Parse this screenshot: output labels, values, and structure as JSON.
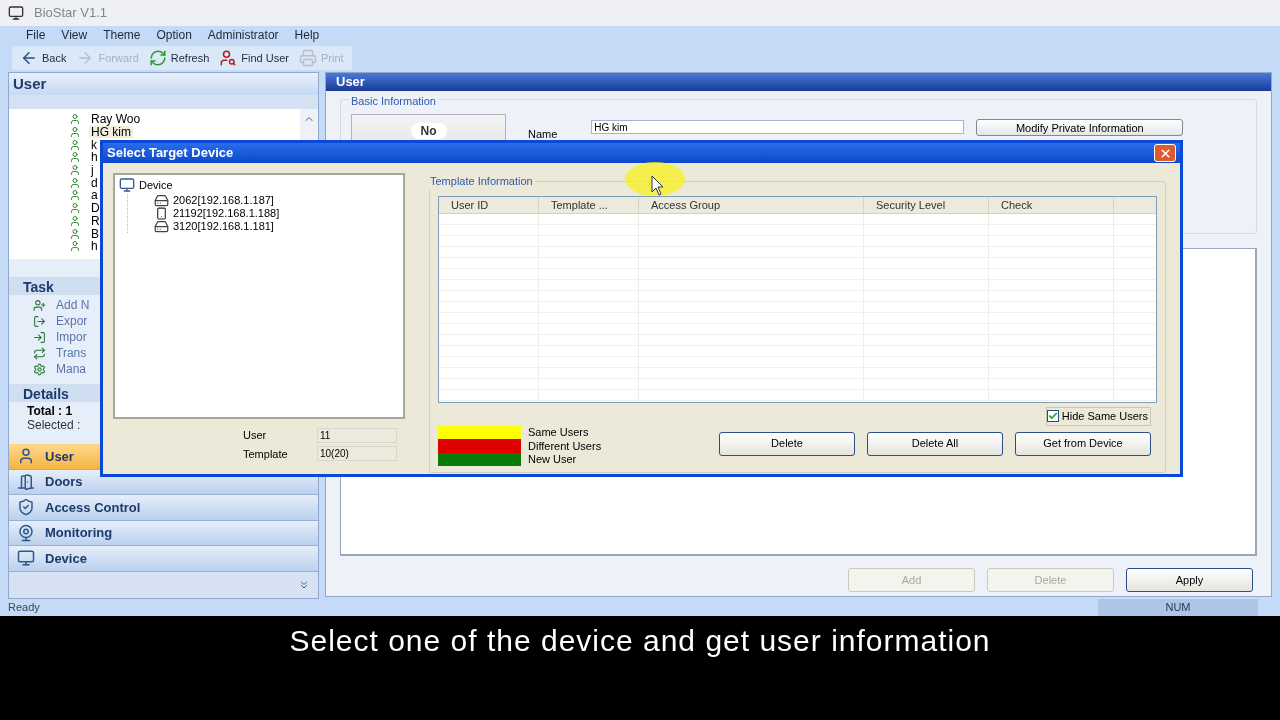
{
  "window": {
    "title": "BioStar V1.1"
  },
  "menu": [
    "File",
    "View",
    "Theme",
    "Option",
    "Administrator",
    "Help"
  ],
  "toolbar": [
    {
      "label": "Back",
      "disabled": false
    },
    {
      "label": "Forward",
      "disabled": true
    },
    {
      "label": "Refresh",
      "disabled": false
    },
    {
      "label": "Find User",
      "disabled": false
    },
    {
      "label": "Print",
      "disabled": true
    }
  ],
  "sidebar": {
    "title": "User",
    "users": [
      {
        "name": "Ray Woo",
        "selected": false
      },
      {
        "name": "HG kim",
        "selected": true
      },
      {
        "name": "k",
        "selected": false
      },
      {
        "name": "h",
        "selected": false
      },
      {
        "name": "j",
        "selected": false
      },
      {
        "name": "d",
        "selected": false
      },
      {
        "name": "a",
        "selected": false
      },
      {
        "name": "D",
        "selected": false
      },
      {
        "name": "R",
        "selected": false
      },
      {
        "name": "B",
        "selected": false
      },
      {
        "name": "h",
        "selected": false
      }
    ],
    "task": {
      "title": "Task",
      "items": [
        "Add N",
        "Expor",
        "Impor",
        "Trans",
        "Mana"
      ]
    },
    "details": {
      "title": "Details",
      "lines": [
        "Total : 1",
        "Selected :"
      ]
    },
    "nav": [
      {
        "label": "User",
        "selected": true
      },
      {
        "label": "Doors",
        "selected": false
      },
      {
        "label": "Access Control",
        "selected": false
      },
      {
        "label": "Monitoring",
        "selected": false
      },
      {
        "label": "Device",
        "selected": false
      }
    ]
  },
  "main": {
    "title": "User",
    "group": "Basic Information",
    "photo_text": "No",
    "name_label": "Name",
    "name_value": "HG kim",
    "modify_button": "Modify Private Information",
    "buttons": [
      {
        "label": "Add",
        "disabled": true
      },
      {
        "label": "Delete",
        "disabled": true
      },
      {
        "label": "Apply",
        "disabled": false
      }
    ]
  },
  "dialog": {
    "title": "Select Target Device",
    "tree": {
      "label": "Device",
      "children": [
        {
          "label": "2062[192.168.1.187]",
          "kind": "terminal"
        },
        {
          "label": "21192[192.168.1.188]",
          "kind": "reader"
        },
        {
          "label": "3120[192.168.1.181]",
          "kind": "terminal"
        }
      ]
    },
    "stats": [
      {
        "label": "User",
        "value": "11"
      },
      {
        "label": "Template",
        "value": "10(20)"
      }
    ],
    "group": "Template Information",
    "columns": [
      "User ID",
      "Template ...",
      "Access Group",
      "Security Level",
      "Check"
    ],
    "legend": [
      {
        "label": "Same Users",
        "color": "#ffff00"
      },
      {
        "label": "Different Users",
        "color": "#e00000"
      },
      {
        "label": "New User",
        "color": "#0a7a0a"
      }
    ],
    "hide_same": {
      "label": "Hide Same Users",
      "checked": true
    },
    "buttons": [
      "Delete",
      "Delete All",
      "Get from Device"
    ]
  },
  "status_bar": {
    "text": "Ready",
    "indicator": "NUM"
  },
  "caption": "Select one of the device and get user information"
}
